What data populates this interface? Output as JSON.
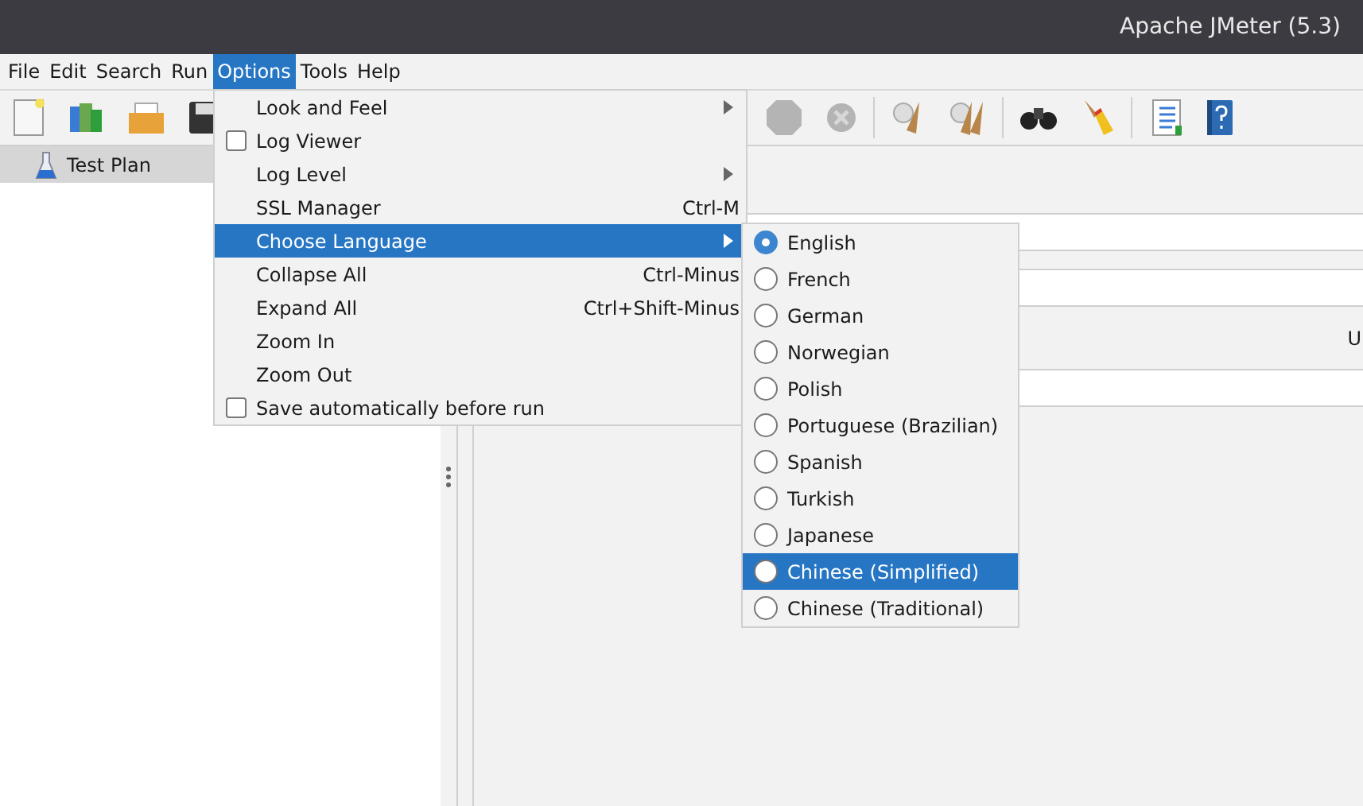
{
  "window": {
    "title": "Apache JMeter (5.3)"
  },
  "menu_bar": [
    {
      "label": "File",
      "selected": false
    },
    {
      "label": "Edit",
      "selected": false
    },
    {
      "label": "Search",
      "selected": false
    },
    {
      "label": "Run",
      "selected": false
    },
    {
      "label": "Options",
      "selected": true
    },
    {
      "label": "Tools",
      "selected": false
    },
    {
      "label": "Help",
      "selected": false
    }
  ],
  "toolbar": {
    "left": [
      {
        "kind": "new",
        "disabled": false
      },
      {
        "kind": "templates",
        "disabled": false
      },
      {
        "kind": "open",
        "disabled": false
      },
      {
        "kind": "save",
        "disabled": false
      }
    ],
    "right": [
      {
        "kind": "stop",
        "disabled": true
      },
      {
        "kind": "shutdown",
        "disabled": true
      },
      {
        "kind": "separator"
      },
      {
        "kind": "clear",
        "disabled": false
      },
      {
        "kind": "clear-all",
        "disabled": false
      },
      {
        "kind": "separator"
      },
      {
        "kind": "search",
        "disabled": false
      },
      {
        "kind": "reset",
        "disabled": false
      },
      {
        "kind": "separator"
      },
      {
        "kind": "function",
        "disabled": false
      },
      {
        "kind": "help",
        "disabled": false
      }
    ]
  },
  "tree": {
    "items": [
      {
        "label": "Test Plan",
        "selected": true
      }
    ]
  },
  "panel": {
    "label": "U"
  },
  "options_menu": [
    {
      "label": "Look and Feel",
      "kind": "submenu",
      "selected": false
    },
    {
      "label": "Log Viewer",
      "kind": "check",
      "checked": false,
      "selected": false
    },
    {
      "label": "Log Level",
      "kind": "submenu",
      "selected": false
    },
    {
      "label": "SSL Manager",
      "kind": "plain",
      "shortcut": "Ctrl-M",
      "selected": false
    },
    {
      "label": "Choose Language",
      "kind": "submenu",
      "selected": true
    },
    {
      "label": "Collapse All",
      "kind": "plain",
      "shortcut": "Ctrl-Minus",
      "selected": false
    },
    {
      "label": "Expand All",
      "kind": "plain",
      "shortcut": "Ctrl+Shift-Minus",
      "selected": false
    },
    {
      "label": "Zoom In",
      "kind": "plain",
      "selected": false
    },
    {
      "label": "Zoom Out",
      "kind": "plain",
      "selected": false
    },
    {
      "label": "Save automatically before run",
      "kind": "check",
      "checked": false,
      "selected": false
    }
  ],
  "language_menu": [
    {
      "label": "English",
      "selected": true,
      "highlighted": false
    },
    {
      "label": "French",
      "selected": false,
      "highlighted": false
    },
    {
      "label": "German",
      "selected": false,
      "highlighted": false
    },
    {
      "label": "Norwegian",
      "selected": false,
      "highlighted": false
    },
    {
      "label": "Polish",
      "selected": false,
      "highlighted": false
    },
    {
      "label": "Portuguese (Brazilian)",
      "selected": false,
      "highlighted": false
    },
    {
      "label": "Spanish",
      "selected": false,
      "highlighted": false
    },
    {
      "label": "Turkish",
      "selected": false,
      "highlighted": false
    },
    {
      "label": "Japanese",
      "selected": false,
      "highlighted": false
    },
    {
      "label": "Chinese (Simplified)",
      "selected": false,
      "highlighted": true
    },
    {
      "label": "Chinese (Traditional)",
      "selected": false,
      "highlighted": false
    }
  ]
}
